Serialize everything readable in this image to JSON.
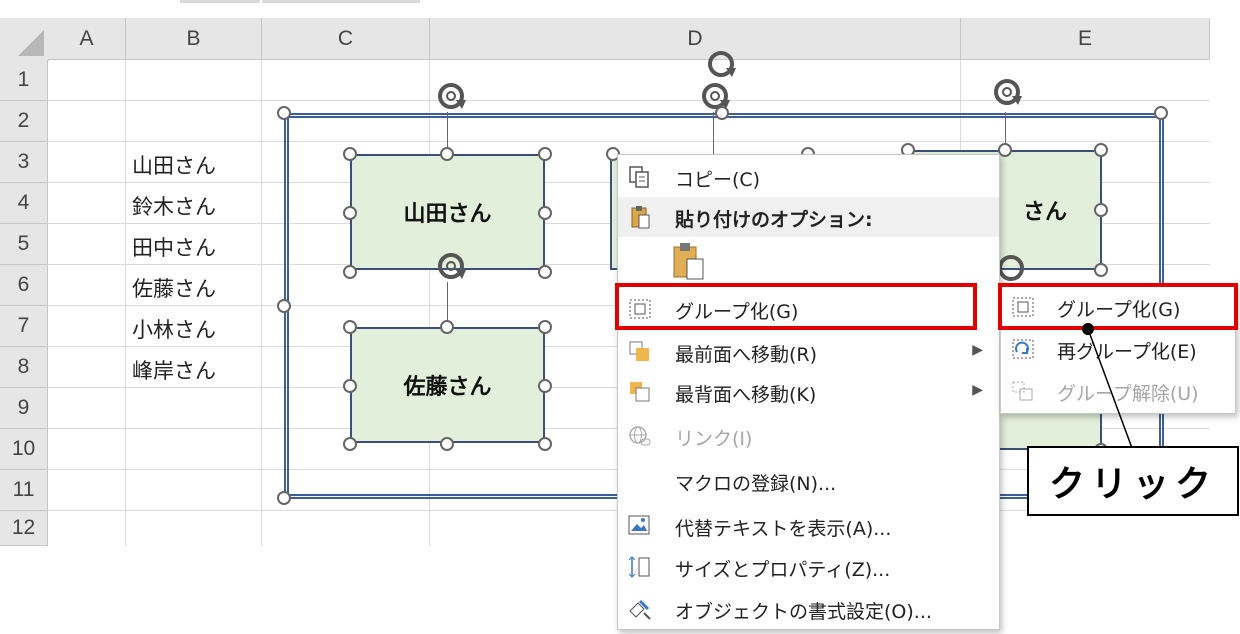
{
  "columns": [
    "A",
    "B",
    "C",
    "D",
    "E"
  ],
  "rows": [
    "1",
    "2",
    "3",
    "4",
    "5",
    "6",
    "7",
    "8",
    "9",
    "10",
    "11",
    "12"
  ],
  "cells_b": [
    "山田さん",
    "鈴木さん",
    "田中さん",
    "佐藤さん",
    "小林さん",
    "峰岸さん"
  ],
  "shapes": {
    "yamada": "山田さん",
    "sato": "佐藤さん",
    "right_partial": "さん"
  },
  "context_menu": {
    "copy": "コピー(C)",
    "paste_options": "貼り付けのオプション:",
    "group": "グループ化(G)",
    "bring_front": "最前面へ移動(R)",
    "send_back": "最背面へ移動(K)",
    "link": "リンク(I)",
    "assign_macro": "マクロの登録(N)...",
    "alt_text": "代替テキストを表示(A)...",
    "size_props": "サイズとプロパティ(Z)...",
    "format_object": "オブジェクトの書式設定(O)..."
  },
  "submenu": {
    "group": "グループ化(G)",
    "regroup": "再グループ化(E)",
    "ungroup": "グループ解除(U)"
  },
  "callout": "クリック",
  "colors": {
    "highlight": "#e00000",
    "shape_fill": "#e2efda",
    "group_border": "#3e5e9a"
  }
}
